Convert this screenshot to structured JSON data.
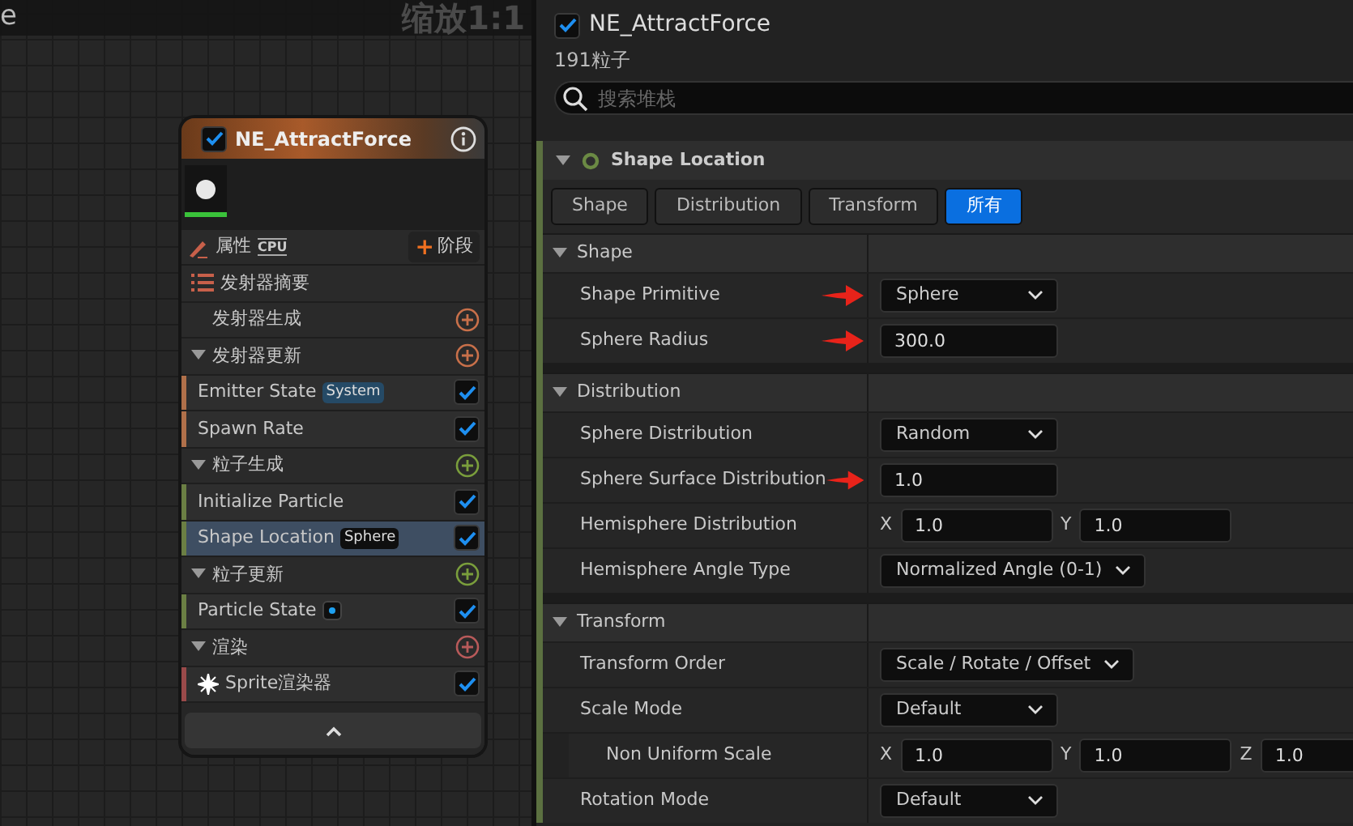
{
  "graph": {
    "title_fragment": "e",
    "zoom_label": "缩放1:1"
  },
  "node": {
    "checked": true,
    "title": "NE_AttractForce",
    "toolbar": {
      "properties_label": "属性",
      "sim_target": "CPU",
      "add_stage_symbol": "+",
      "add_stage_label": "阶段"
    },
    "rows": [
      {
        "kind": "summary",
        "label": "发射器摘要"
      },
      {
        "kind": "spawn",
        "label": "发射器生成",
        "color": "#c8704a"
      },
      {
        "kind": "stage",
        "label": "发射器更新",
        "expanded": true,
        "color": "#c8704a"
      },
      {
        "kind": "module",
        "label": "Emitter State",
        "badge": {
          "kind": "text",
          "text": "System"
        },
        "enabled": true,
        "selected": false,
        "color": "#b0704a"
      },
      {
        "kind": "module",
        "label": "Spawn Rate",
        "enabled": true,
        "selected": false,
        "color": "#b0704a"
      },
      {
        "kind": "stage",
        "label": "粒子生成",
        "expanded": true,
        "color": "#7a9e3c"
      },
      {
        "kind": "module",
        "label": "Initialize Particle",
        "enabled": true,
        "selected": false,
        "color": "#6b7f44"
      },
      {
        "kind": "module",
        "label": "Shape Location",
        "badge": {
          "kind": "text",
          "text": "Sphere"
        },
        "enabled": true,
        "selected": true,
        "color": "#6b7f44"
      },
      {
        "kind": "stage",
        "label": "粒子更新",
        "expanded": true,
        "color": "#7a9e3c"
      },
      {
        "kind": "module",
        "label": "Particle State",
        "badge": {
          "kind": "dot"
        },
        "enabled": true,
        "selected": false,
        "color": "#6b7f44"
      },
      {
        "kind": "stage",
        "label": "渲染",
        "expanded": true,
        "color": "#b85a5a"
      },
      {
        "kind": "renderer",
        "label": "Sprite渲染器",
        "enabled": true,
        "selected": false,
        "color": "#9a4a4a"
      }
    ]
  },
  "details": {
    "checked": true,
    "title": "NE_AttractForce",
    "particle_count": "191粒子",
    "search": {
      "placeholder": "搜索堆栈"
    },
    "module": {
      "title": "Shape Location",
      "expanded": true,
      "filters": [
        {
          "label": "Shape",
          "selected": false
        },
        {
          "label": "Distribution",
          "selected": false
        },
        {
          "label": "Transform",
          "selected": false
        },
        {
          "label": "所有",
          "selected": true
        }
      ],
      "categories": [
        {
          "title": "Shape",
          "expanded": true,
          "properties": [
            {
              "label": "Shape Primitive",
              "kind": "dropdown",
              "value": "Sphere",
              "annotated": true
            },
            {
              "label": "Sphere Radius",
              "kind": "number",
              "value": "300.0",
              "annotated": true
            }
          ]
        },
        {
          "title": "Distribution",
          "expanded": true,
          "properties": [
            {
              "label": "Sphere Distribution",
              "kind": "dropdown",
              "value": "Random",
              "annotated": false
            },
            {
              "label": "Sphere Surface Distribution",
              "kind": "number",
              "value": "1.0",
              "annotated": true
            },
            {
              "label": "Hemisphere Distribution",
              "kind": "vector",
              "components": [
                {
                  "axis": "X",
                  "value": "1.0"
                },
                {
                  "axis": "Y",
                  "value": "1.0"
                }
              ],
              "annotated": false
            },
            {
              "label": "Hemisphere Angle Type",
              "kind": "dropdown",
              "value": "Normalized Angle (0-1)",
              "annotated": false
            }
          ]
        },
        {
          "title": "Transform",
          "expanded": true,
          "properties": [
            {
              "label": "Transform Order",
              "kind": "dropdown",
              "value": "Scale / Rotate / Offset",
              "annotated": false
            },
            {
              "label": "Scale Mode",
              "kind": "dropdown",
              "value": "Default",
              "annotated": false,
              "children": [
                {
                  "label": "Non Uniform Scale",
                  "kind": "vector",
                  "components": [
                    {
                      "axis": "X",
                      "value": "1.0"
                    },
                    {
                      "axis": "Y",
                      "value": "1.0"
                    },
                    {
                      "axis": "Z",
                      "value": "1.0"
                    }
                  ],
                  "annotated": false
                }
              ]
            },
            {
              "label": "Rotation Mode",
              "kind": "dropdown",
              "value": "Default",
              "annotated": false
            }
          ]
        }
      ]
    }
  }
}
